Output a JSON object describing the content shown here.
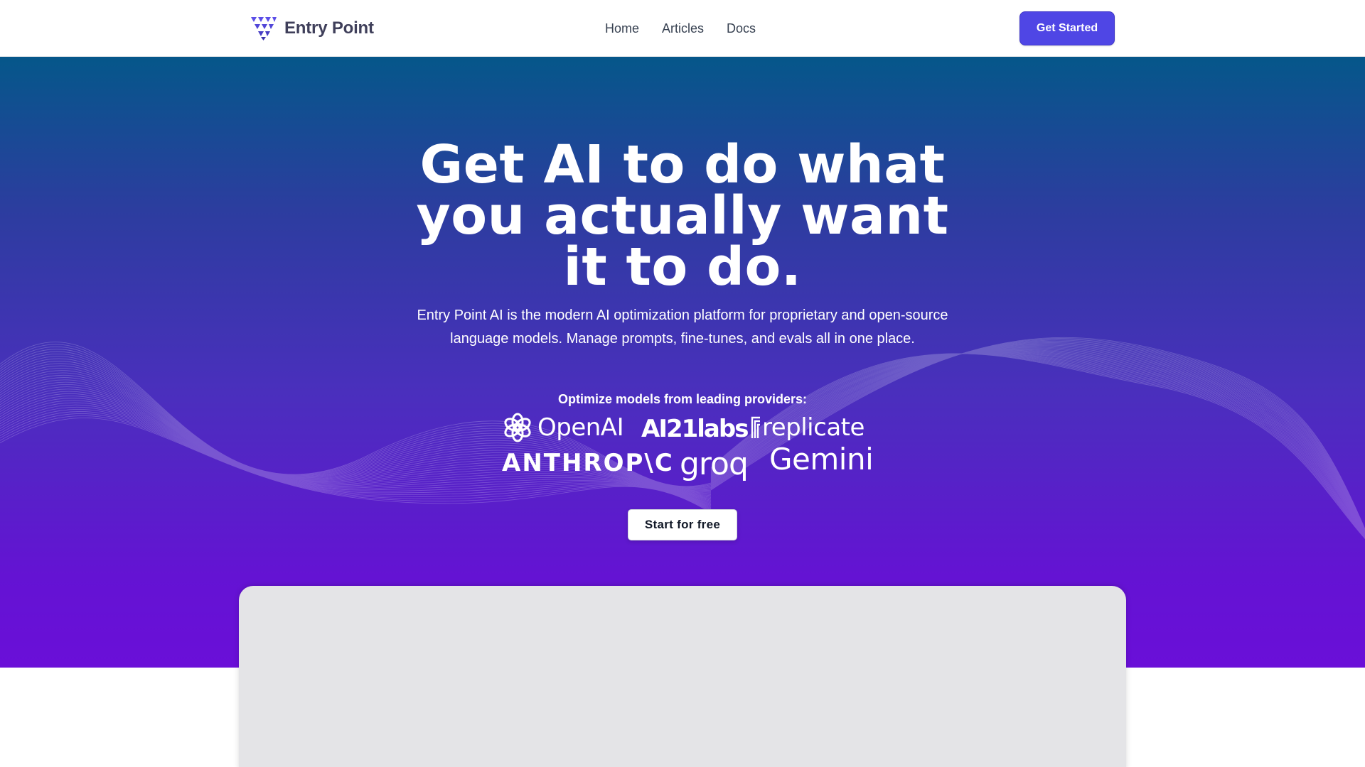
{
  "navbar": {
    "brand": {
      "name": "Entry Point",
      "logo_icon": "triangle-dots-logo-icon"
    },
    "links": [
      {
        "label": "Home"
      },
      {
        "label": "Articles"
      },
      {
        "label": "Docs"
      }
    ],
    "cta_label": "Get Started"
  },
  "hero": {
    "title_line1": "Get AI to do what",
    "title_line2": "you actually want",
    "title_line3": "it to do.",
    "subtitle_line1": "Entry Point AI is the modern AI optimization platform for proprietary and open-source",
    "subtitle_line2": "language models. Manage prompts, fine-tunes, and evals all in one place.",
    "providers_label": "Optimize models from leading providers:",
    "providers": {
      "openai": "OpenAI",
      "ai21": "AI21labs",
      "replicate": "replicate",
      "anthropic": "ANTHROP\\C",
      "groq": "groq",
      "gemini": "Gemini"
    },
    "cta_label": "Start for free"
  },
  "colors": {
    "accent": "#4f46e5",
    "hero_top": "#05578a",
    "hero_bottom": "#6a0fd8",
    "brand_text": "#3f3f5a",
    "preview_bg": "#e4e4e7"
  }
}
